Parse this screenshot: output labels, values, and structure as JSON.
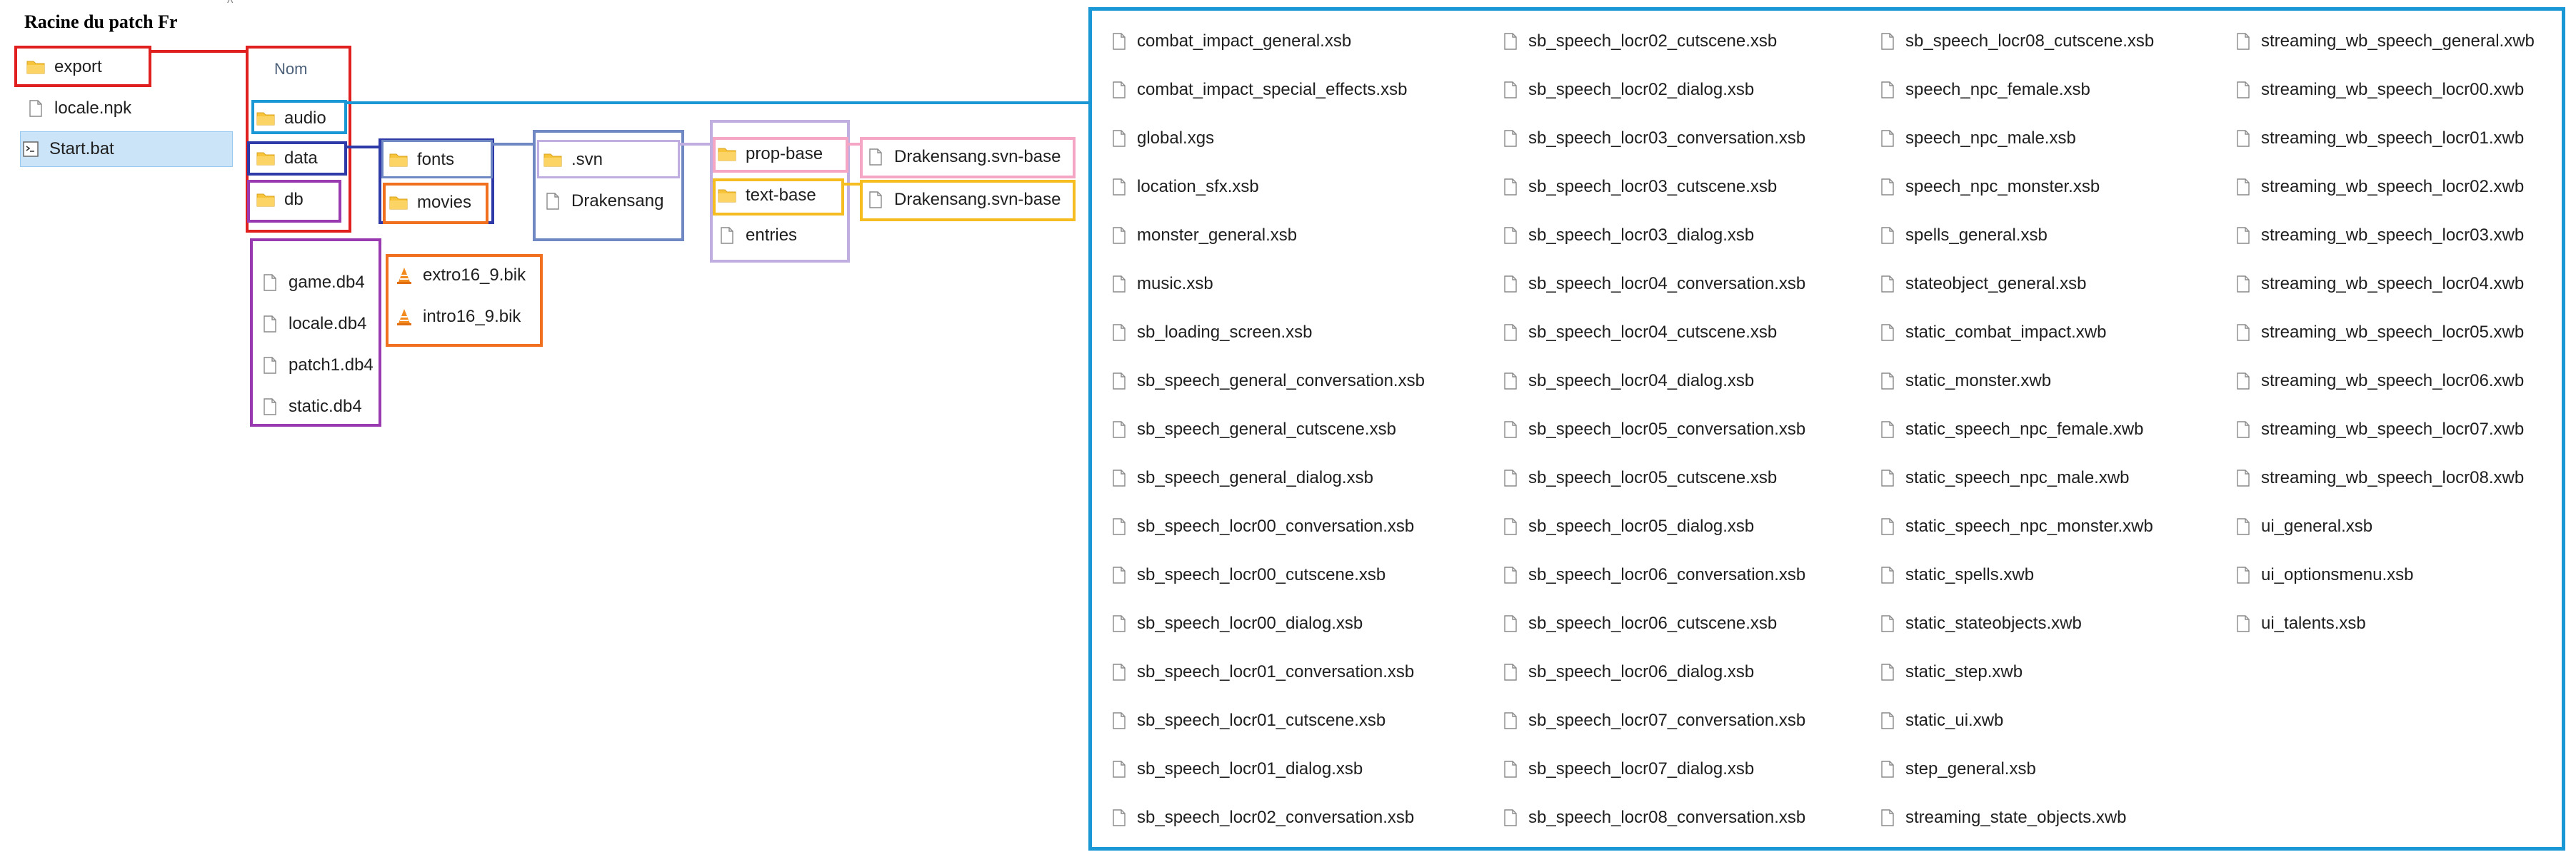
{
  "title": "Racine du patch Fr",
  "header": {
    "name_column": "Nom"
  },
  "root_items": [
    {
      "name": "export",
      "type": "folder"
    },
    {
      "name": "locale.npk",
      "type": "file"
    },
    {
      "name": "Start.bat",
      "type": "batch"
    }
  ],
  "export_items": [
    {
      "name": "audio",
      "type": "folder"
    },
    {
      "name": "data",
      "type": "folder"
    },
    {
      "name": "db",
      "type": "folder"
    }
  ],
  "db_files": [
    "game.db4",
    "locale.db4",
    "patch1.db4",
    "static.db4"
  ],
  "data_items": [
    "fonts",
    "movies"
  ],
  "movies_files": [
    "extro16_9.bik",
    "intro16_9.bik"
  ],
  "fonts_items": [
    {
      "name": ".svn",
      "type": "folder"
    },
    {
      "name": "Drakensang",
      "type": "file"
    }
  ],
  "svn_items": [
    {
      "name": "prop-base",
      "type": "folder"
    },
    {
      "name": "text-base",
      "type": "folder"
    },
    {
      "name": "entries",
      "type": "file"
    }
  ],
  "prop_base_items": [
    "Drakensang.svn-base"
  ],
  "text_base_items": [
    "Drakensang.svn-base"
  ],
  "audio_files": [
    [
      "combat_impact_general.xsb",
      "combat_impact_special_effects.xsb",
      "global.xgs",
      "location_sfx.xsb",
      "monster_general.xsb",
      "music.xsb",
      "sb_loading_screen.xsb",
      "sb_speech_general_conversation.xsb",
      "sb_speech_general_cutscene.xsb",
      "sb_speech_general_dialog.xsb",
      "sb_speech_locr00_conversation.xsb",
      "sb_speech_locr00_cutscene.xsb",
      "sb_speech_locr00_dialog.xsb",
      "sb_speech_locr01_conversation.xsb",
      "sb_speech_locr01_cutscene.xsb",
      "sb_speech_locr01_dialog.xsb",
      "sb_speech_locr02_conversation.xsb"
    ],
    [
      "sb_speech_locr02_cutscene.xsb",
      "sb_speech_locr02_dialog.xsb",
      "sb_speech_locr03_conversation.xsb",
      "sb_speech_locr03_cutscene.xsb",
      "sb_speech_locr03_dialog.xsb",
      "sb_speech_locr04_conversation.xsb",
      "sb_speech_locr04_cutscene.xsb",
      "sb_speech_locr04_dialog.xsb",
      "sb_speech_locr05_conversation.xsb",
      "sb_speech_locr05_cutscene.xsb",
      "sb_speech_locr05_dialog.xsb",
      "sb_speech_locr06_conversation.xsb",
      "sb_speech_locr06_cutscene.xsb",
      "sb_speech_locr06_dialog.xsb",
      "sb_speech_locr07_conversation.xsb",
      "sb_speech_locr07_dialog.xsb",
      "sb_speech_locr08_conversation.xsb"
    ],
    [
      "sb_speech_locr08_cutscene.xsb",
      "speech_npc_female.xsb",
      "speech_npc_male.xsb",
      "speech_npc_monster.xsb",
      "spells_general.xsb",
      "stateobject_general.xsb",
      "static_combat_impact.xwb",
      "static_monster.xwb",
      "static_speech_npc_female.xwb",
      "static_speech_npc_male.xwb",
      "static_speech_npc_monster.xwb",
      "static_spells.xwb",
      "static_stateobjects.xwb",
      "static_step.xwb",
      "static_ui.xwb",
      "step_general.xsb",
      "streaming_state_objects.xwb"
    ],
    [
      "streaming_wb_speech_general.xwb",
      "streaming_wb_speech_locr00.xwb",
      "streaming_wb_speech_locr01.xwb",
      "streaming_wb_speech_locr02.xwb",
      "streaming_wb_speech_locr03.xwb",
      "streaming_wb_speech_locr04.xwb",
      "streaming_wb_speech_locr05.xwb",
      "streaming_wb_speech_locr06.xwb",
      "streaming_wb_speech_locr07.xwb",
      "streaming_wb_speech_locr08.xwb",
      "ui_general.xsb",
      "ui_optionsmenu.xsb",
      "ui_talents.xsb"
    ]
  ],
  "colors": {
    "red": "#e0201f",
    "blue_audio": "#1a98d5",
    "navy_data": "#2e3aa8",
    "purple_db": "#9a3ab0",
    "orange_movies": "#f07020",
    "steel_fonts": "#6f87c2",
    "lavender_svn": "#c0aee0",
    "pink_prop": "#f4a6c4",
    "yellow_text": "#f5bd1f",
    "folder": "#f8c53a",
    "selection": "#cce4f7"
  }
}
